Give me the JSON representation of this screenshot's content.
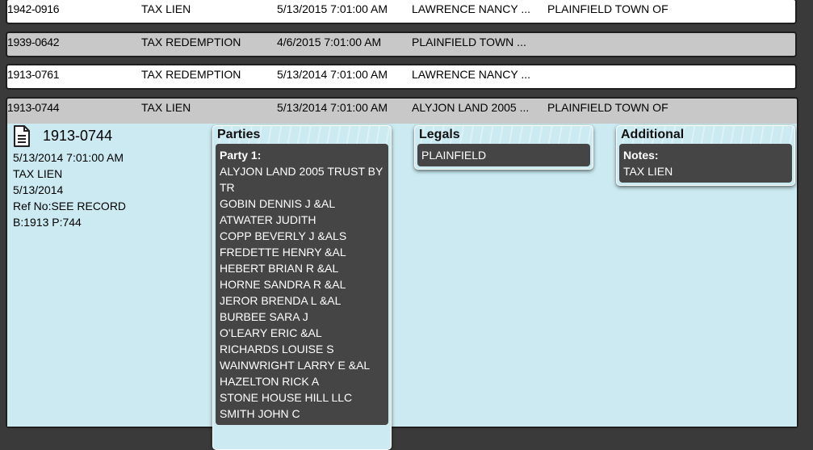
{
  "rows": [
    {
      "id": "1942-0916",
      "type": "TAX LIEN",
      "date": "5/13/2015 7:01:00 AM",
      "party1": "LAWRENCE NANCY ...",
      "party2": "PLAINFIELD TOWN OF"
    },
    {
      "id": "1939-0642",
      "type": "TAX REDEMPTION",
      "date": "4/6/2015 7:01:00 AM",
      "party1": "PLAINFIELD TOWN ...",
      "party2": ""
    },
    {
      "id": "1913-0761",
      "type": "TAX REDEMPTION",
      "date": "5/13/2014 7:01:00 AM",
      "party1": "LAWRENCE NANCY ...",
      "party2": ""
    },
    {
      "id": "1913-0744",
      "type": "TAX LIEN",
      "date": "5/13/2014 7:01:00 AM",
      "party1": "ALYJON LAND 2005 ...",
      "party2": "PLAINFIELD TOWN OF"
    }
  ],
  "detail": {
    "title": "1913-0744",
    "icon": "document-icon",
    "info": [
      "5/13/2014 7:01:00 AM",
      "TAX LIEN",
      "5/13/2014",
      "Ref No:SEE RECORD",
      "B:1913 P:744"
    ],
    "parties": {
      "heading": "Parties",
      "label": "Party 1:",
      "names": [
        "ALYJON LAND 2005 TRUST BY TR",
        "GOBIN DENNIS J &AL",
        "ATWATER JUDITH",
        "COPP BEVERLY J &ALS",
        "FREDETTE HENRY &AL",
        "HEBERT BRIAN R &AL",
        "HORNE SANDRA R &AL",
        "JEROR BRENDA L &AL",
        "BURBEE SARA J",
        "O'LEARY ERIC &AL",
        "RICHARDS LOUISE S",
        "WAINWRIGHT LARRY E &AL",
        "HAZELTON RICK A",
        "STONE HOUSE HILL LLC",
        "SMITH JOHN C"
      ]
    },
    "legals": {
      "heading": "Legals",
      "value": "PLAINFIELD"
    },
    "additional": {
      "heading": "Additional",
      "notes_label": "Notes:",
      "notes": "TAX LIEN"
    }
  }
}
